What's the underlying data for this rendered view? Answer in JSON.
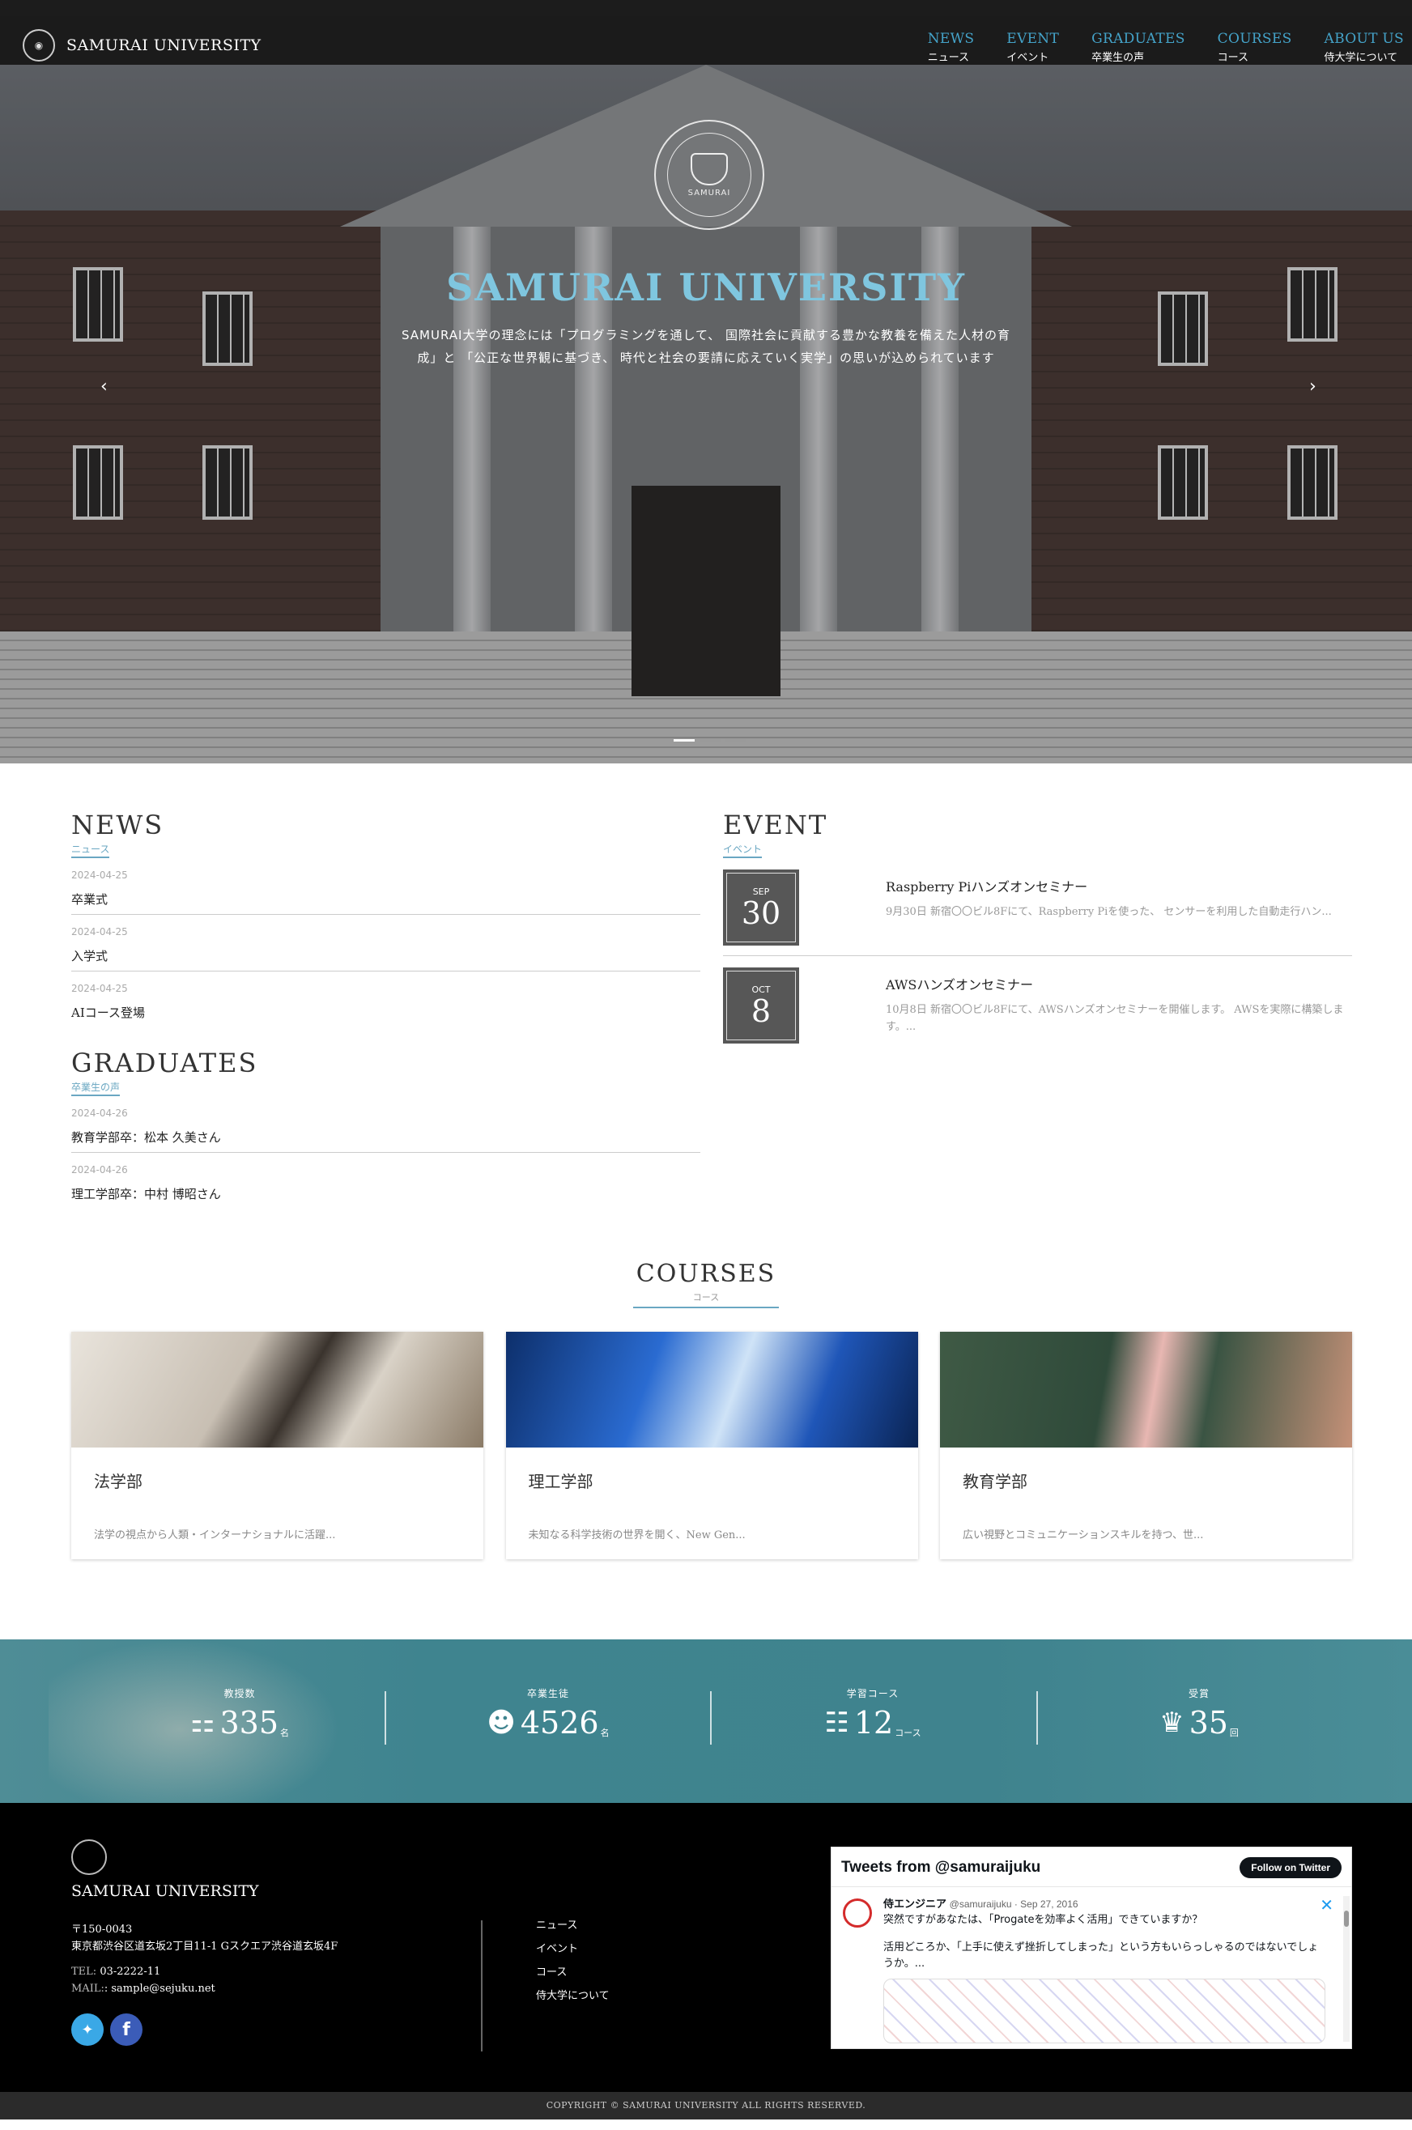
{
  "header": {
    "brand": "SAMURAI UNIVERSITY",
    "nav": [
      {
        "en": "NEWS",
        "ja": "ニュース"
      },
      {
        "en": "EVENT",
        "ja": "イベント"
      },
      {
        "en": "GRADUATES",
        "ja": "卒業生の声"
      },
      {
        "en": "COURSES",
        "ja": "コース"
      },
      {
        "en": "ABOUT US",
        "ja": "侍大学について"
      }
    ]
  },
  "hero": {
    "logo_text": "SAMURAI",
    "title": "SAMURAI UNIVERSITY",
    "lead": "SAMURAI大学の理念には「プログラミングを通して、 国際社会に貢献する豊かな教養を備えた人材の育成」と 「公正な世界観に基づき、 時代と社会の要請に応えていく実学」の思いが込められています",
    "prev": "‹",
    "next": "›",
    "slides": 3,
    "active_slide": 1
  },
  "news": {
    "title_en": "NEWS",
    "title_ja": "ニュース",
    "items": [
      {
        "date": "2024-04-25",
        "title": "卒業式"
      },
      {
        "date": "2024-04-25",
        "title": "入学式"
      },
      {
        "date": "2024-04-25",
        "title": "AIコース登場"
      }
    ]
  },
  "graduates": {
    "title_en": "GRADUATES",
    "title_ja": "卒業生の声",
    "items": [
      {
        "date": "2024-04-26",
        "title": "教育学部卒：松本 久美さん"
      },
      {
        "date": "2024-04-26",
        "title": "理工学部卒：中村 博昭さん"
      }
    ]
  },
  "event": {
    "title_en": "EVENT",
    "title_ja": "イベント",
    "items": [
      {
        "month": "SEP",
        "day": "30",
        "title": "Raspberry Piハンズオンセミナー",
        "desc": "9月30日 新宿〇〇ビル8Fにて、Raspberry Piを使った、 センサーを利用した自動走行ハン..."
      },
      {
        "month": "OCT",
        "day": "8",
        "title": "AWSハンズオンセミナー",
        "desc": "10月8日 新宿〇〇ビル8Fにて、AWSハンズオンセミナーを開催します。 AWSを実際に構築します。..."
      }
    ]
  },
  "courses": {
    "title_en": "COURSES",
    "title_ja": "コース",
    "items": [
      {
        "title": "法学部",
        "desc": "法学の視点から人類・インターナショナルに活躍..."
      },
      {
        "title": "理工学部",
        "desc": "未知なる科学技術の世界を開く、New Gen..."
      },
      {
        "title": "教育学部",
        "desc": "広い視野とコミュニケーションスキルを持つ、世..."
      }
    ]
  },
  "stats": [
    {
      "label": "教授数",
      "value": "335",
      "unit": "名",
      "icon": "teacher-icon"
    },
    {
      "label": "卒業生徒",
      "value": "4526",
      "unit": "名",
      "icon": "graduate-icon"
    },
    {
      "label": "学習コース",
      "value": "12",
      "unit": "コース",
      "icon": "books-icon"
    },
    {
      "label": "受賞",
      "value": "35",
      "unit": "回",
      "icon": "trophy-icon"
    }
  ],
  "footer": {
    "name": "SAMURAI UNIVERSITY",
    "zip": "〒150-0043",
    "address": "東京都渋谷区道玄坂2丁目11-1 Gスクエア渋谷道玄坂4F",
    "tel_label": "TEL:",
    "tel": "03-2222-11",
    "mail_label": "MAIL:",
    "mail": ": sample@sejuku.net",
    "links": [
      "ニュース",
      "イベント",
      "コース",
      "侍大学について"
    ],
    "twitter": {
      "header": "Tweets from @samuraijuku",
      "follow": "Follow on Twitter",
      "author": "侍エンジニア",
      "handle": "@samuraijuku · Sep 27, 2016",
      "text1": "突然ですがあなたは、「Progateを効率よく活用」できていますか？",
      "text2": "活用どころか、「上手に使えず挫折してしまった」という方もいらっしゃるのではないでしょうか。..."
    },
    "copyright": "COPYRIGHT © SAMURAI UNIVERSITY ALL RIGHTS RESERVED."
  },
  "colors": {
    "accent": "#44a3c9",
    "hero_title": "#7fc6df",
    "stats_bg": "#3f848f",
    "footer_bg": "#000000"
  }
}
